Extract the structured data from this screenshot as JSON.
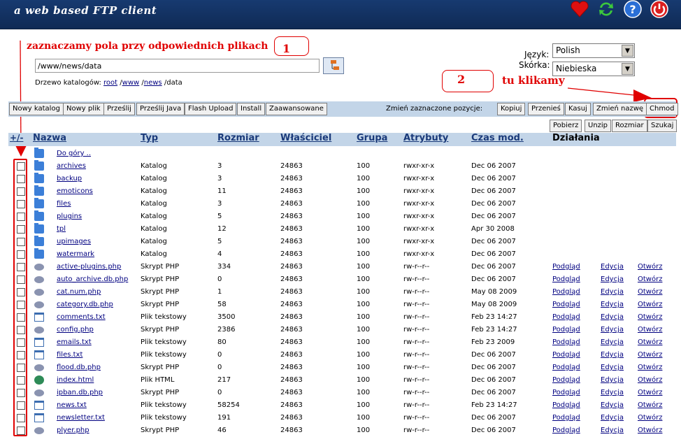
{
  "header": {
    "title": "a web based FTP client",
    "icons": [
      "favorites-heart-icon",
      "refresh-icon",
      "help-icon",
      "power-icon"
    ]
  },
  "annotations": {
    "note1": "zaznaczamy pola przy odpowiednich plikach",
    "num1": "1",
    "num2": "2",
    "note2": "tu klikamy"
  },
  "path": {
    "value": "/www/news/data"
  },
  "breadcrumb": {
    "label": "Drzewo katalogów:",
    "parts": [
      "root",
      "www",
      "news"
    ],
    "current": "data"
  },
  "settings": {
    "language_label": "Język:",
    "language_value": "Polish",
    "skin_label": "Skórka:",
    "skin_value": "Niebieska"
  },
  "toolbar": {
    "new_folder": "Nowy katalog",
    "new_file": "Nowy plik",
    "send": "Prześlij",
    "send_java": "Prześlij Java",
    "flash_upload": "Flash Upload",
    "install": "Install",
    "advanced": "Zaawansowane",
    "change_selected": "Zmień zaznaczone pozycje:",
    "copy": "Kopiuj",
    "move": "Przenieś",
    "delete": "Kasuj",
    "rename": "Zmień nazwę",
    "chmod": "Chmod",
    "download": "Pobierz",
    "unzip": "Unzip",
    "size": "Rozmiar",
    "search": "Szukaj"
  },
  "columns": {
    "toggle": "+/-",
    "name": "Nazwa",
    "type": "Typ",
    "size": "Rozmiar",
    "owner": "Właściciel",
    "group": "Grupa",
    "attrs": "Atrybuty",
    "mtime": "Czas mod.",
    "actions": "Działania"
  },
  "up_label": "Do góry ..",
  "actions": {
    "view": "Podgląd",
    "edit": "Edycja",
    "open": "Otwórz"
  },
  "files": [
    {
      "name": "archives",
      "type": "Katalog",
      "size": "3",
      "owner": "24863",
      "group": "100",
      "attrs": "rwxr-xr-x",
      "mtime": "Dec 06 2007",
      "icon": "folder"
    },
    {
      "name": "backup",
      "type": "Katalog",
      "size": "3",
      "owner": "24863",
      "group": "100",
      "attrs": "rwxr-xr-x",
      "mtime": "Dec 06 2007",
      "icon": "folder"
    },
    {
      "name": "emoticons",
      "type": "Katalog",
      "size": "11",
      "owner": "24863",
      "group": "100",
      "attrs": "rwxr-xr-x",
      "mtime": "Dec 06 2007",
      "icon": "folder"
    },
    {
      "name": "files",
      "type": "Katalog",
      "size": "3",
      "owner": "24863",
      "group": "100",
      "attrs": "rwxr-xr-x",
      "mtime": "Dec 06 2007",
      "icon": "folder"
    },
    {
      "name": "plugins",
      "type": "Katalog",
      "size": "5",
      "owner": "24863",
      "group": "100",
      "attrs": "rwxr-xr-x",
      "mtime": "Dec 06 2007",
      "icon": "folder"
    },
    {
      "name": "tpl",
      "type": "Katalog",
      "size": "12",
      "owner": "24863",
      "group": "100",
      "attrs": "rwxr-xr-x",
      "mtime": "Apr 30 2008",
      "icon": "folder"
    },
    {
      "name": "upimages",
      "type": "Katalog",
      "size": "5",
      "owner": "24863",
      "group": "100",
      "attrs": "rwxr-xr-x",
      "mtime": "Dec 06 2007",
      "icon": "folder"
    },
    {
      "name": "watermark",
      "type": "Katalog",
      "size": "4",
      "owner": "24863",
      "group": "100",
      "attrs": "rwxr-xr-x",
      "mtime": "Dec 06 2007",
      "icon": "folder"
    },
    {
      "name": "active-plugins.php",
      "type": "Skrypt PHP",
      "size": "334",
      "owner": "24863",
      "group": "100",
      "attrs": "rw-r--r--",
      "mtime": "Dec 06 2007",
      "icon": "php"
    },
    {
      "name": "auto_archive.db.php",
      "type": "Skrypt PHP",
      "size": "0",
      "owner": "24863",
      "group": "100",
      "attrs": "rw-r--r--",
      "mtime": "Dec 06 2007",
      "icon": "php"
    },
    {
      "name": "cat.num.php",
      "type": "Skrypt PHP",
      "size": "1",
      "owner": "24863",
      "group": "100",
      "attrs": "rw-r--r--",
      "mtime": "May 08 2009",
      "icon": "php"
    },
    {
      "name": "category.db.php",
      "type": "Skrypt PHP",
      "size": "58",
      "owner": "24863",
      "group": "100",
      "attrs": "rw-r--r--",
      "mtime": "May 08 2009",
      "icon": "php"
    },
    {
      "name": "comments.txt",
      "type": "Plik tekstowy",
      "size": "3500",
      "owner": "24863",
      "group": "100",
      "attrs": "rw-r--r--",
      "mtime": "Feb 23 14:27",
      "icon": "txt"
    },
    {
      "name": "config.php",
      "type": "Skrypt PHP",
      "size": "2386",
      "owner": "24863",
      "group": "100",
      "attrs": "rw-r--r--",
      "mtime": "Feb 23 14:27",
      "icon": "php"
    },
    {
      "name": "emails.txt",
      "type": "Plik tekstowy",
      "size": "80",
      "owner": "24863",
      "group": "100",
      "attrs": "rw-r--r--",
      "mtime": "Feb 23 2009",
      "icon": "txt"
    },
    {
      "name": "files.txt",
      "type": "Plik tekstowy",
      "size": "0",
      "owner": "24863",
      "group": "100",
      "attrs": "rw-r--r--",
      "mtime": "Dec 06 2007",
      "icon": "txt"
    },
    {
      "name": "flood.db.php",
      "type": "Skrypt PHP",
      "size": "0",
      "owner": "24863",
      "group": "100",
      "attrs": "rw-r--r--",
      "mtime": "Dec 06 2007",
      "icon": "php"
    },
    {
      "name": "index.html",
      "type": "Plik HTML",
      "size": "217",
      "owner": "24863",
      "group": "100",
      "attrs": "rw-r--r--",
      "mtime": "Dec 06 2007",
      "icon": "html"
    },
    {
      "name": "ipban.db.php",
      "type": "Skrypt PHP",
      "size": "0",
      "owner": "24863",
      "group": "100",
      "attrs": "rw-r--r--",
      "mtime": "Dec 06 2007",
      "icon": "php"
    },
    {
      "name": "news.txt",
      "type": "Plik tekstowy",
      "size": "58254",
      "owner": "24863",
      "group": "100",
      "attrs": "rw-r--r--",
      "mtime": "Feb 23 14:27",
      "icon": "txt"
    },
    {
      "name": "newsletter.txt",
      "type": "Plik tekstowy",
      "size": "191",
      "owner": "24863",
      "group": "100",
      "attrs": "rw-r--r--",
      "mtime": "Dec 06 2007",
      "icon": "txt"
    },
    {
      "name": "plyer.php",
      "type": "Skrypt PHP",
      "size": "46",
      "owner": "24863",
      "group": "100",
      "attrs": "rw-r--r--",
      "mtime": "Dec 06 2007",
      "icon": "php"
    }
  ],
  "colors": {
    "header_bg": "#173a70",
    "band": "#c3d5e8",
    "annotation": "#e00000",
    "link": "#000080"
  }
}
